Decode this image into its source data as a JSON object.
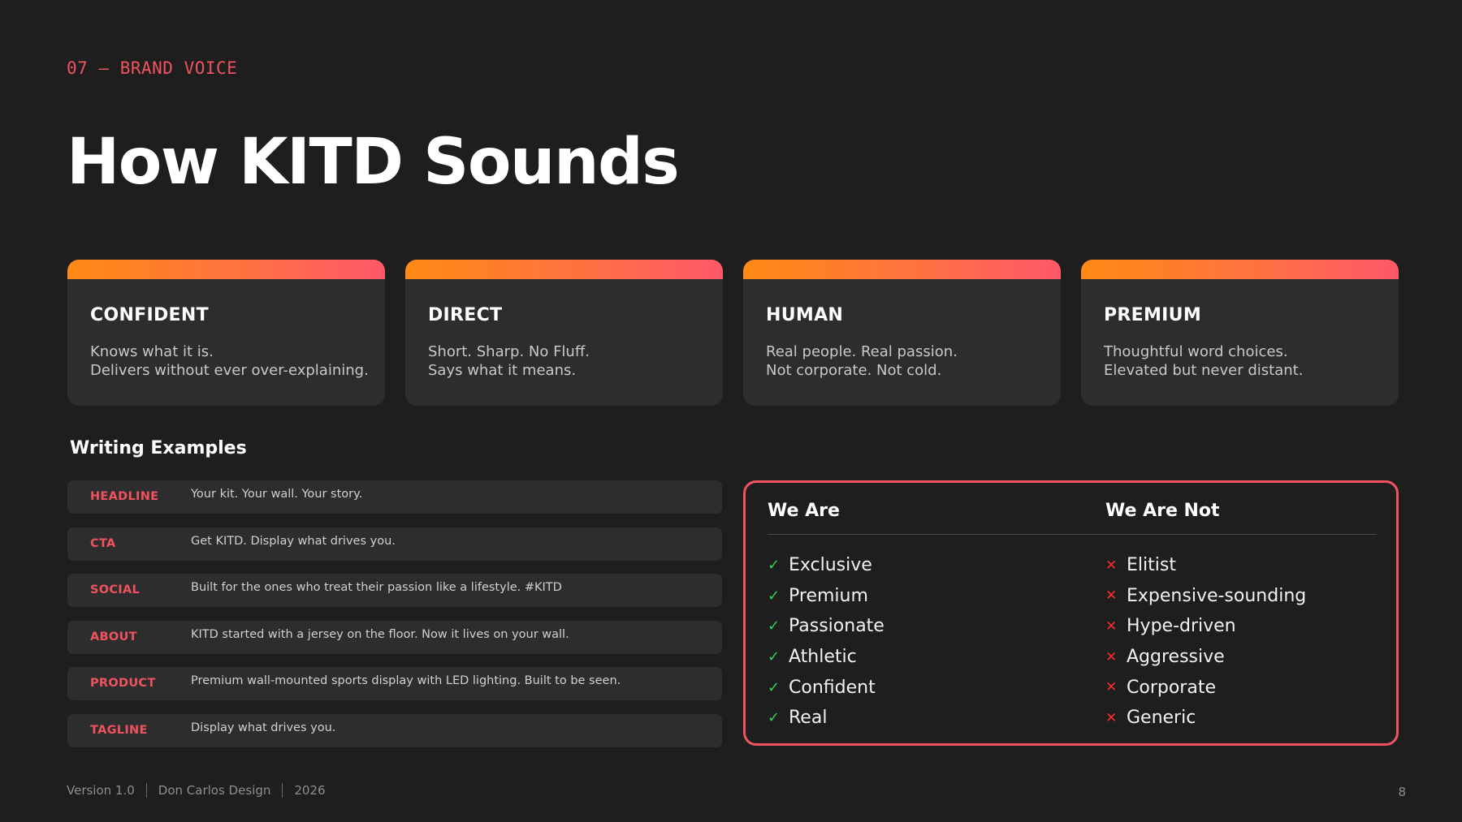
{
  "header": {
    "eyebrow": "07 — BRAND VOICE",
    "title": "How KITD Sounds"
  },
  "accent_color": "#f0525f",
  "gradient_colors": [
    "#ff8a14",
    "#ff5869"
  ],
  "cards": [
    {
      "title": "CONFIDENT",
      "lines": [
        "Knows what it is.",
        "Delivers without ever over-explaining."
      ]
    },
    {
      "title": "DIRECT",
      "lines": [
        "Short. Sharp. No Fluff.",
        "Says what it means."
      ]
    },
    {
      "title": "HUMAN",
      "lines": [
        "Real people. Real passion.",
        "Not corporate. Not cold."
      ]
    },
    {
      "title": "PREMIUM",
      "lines": [
        "Thoughtful word choices.",
        "Elevated but never distant."
      ]
    }
  ],
  "examples": {
    "heading": "Writing Examples",
    "rows": [
      {
        "label": "HEADLINE",
        "text": "Your kit. Your wall. Your story."
      },
      {
        "label": "CTA",
        "text": "Get KITD. Display what drives you."
      },
      {
        "label": "SOCIAL",
        "text": "Built for the ones who treat their passion like a lifestyle. #KITD"
      },
      {
        "label": "ABOUT",
        "text": "KITD started with a jersey on the floor. Now it lives on your wall."
      },
      {
        "label": "PRODUCT",
        "text": "Premium wall-mounted sports display with LED lighting. Built to be seen."
      },
      {
        "label": "TAGLINE",
        "text": "Display what drives you."
      }
    ]
  },
  "compare": {
    "we_are": {
      "heading": "We Are",
      "icon": "check-icon",
      "glyph": "✓",
      "items": [
        "Exclusive",
        "Premium",
        "Passionate",
        "Athletic",
        "Confident",
        "Real"
      ]
    },
    "we_are_not": {
      "heading": "We Are Not",
      "icon": "cross-icon",
      "glyph": "✕",
      "items": [
        "Elitist",
        "Expensive-sounding",
        "Hype-driven",
        "Aggressive",
        "Corporate",
        "Generic"
      ]
    }
  },
  "footer": {
    "version": "Version 1.0",
    "author": "Don Carlos Design",
    "year": "2026",
    "page": "8"
  }
}
